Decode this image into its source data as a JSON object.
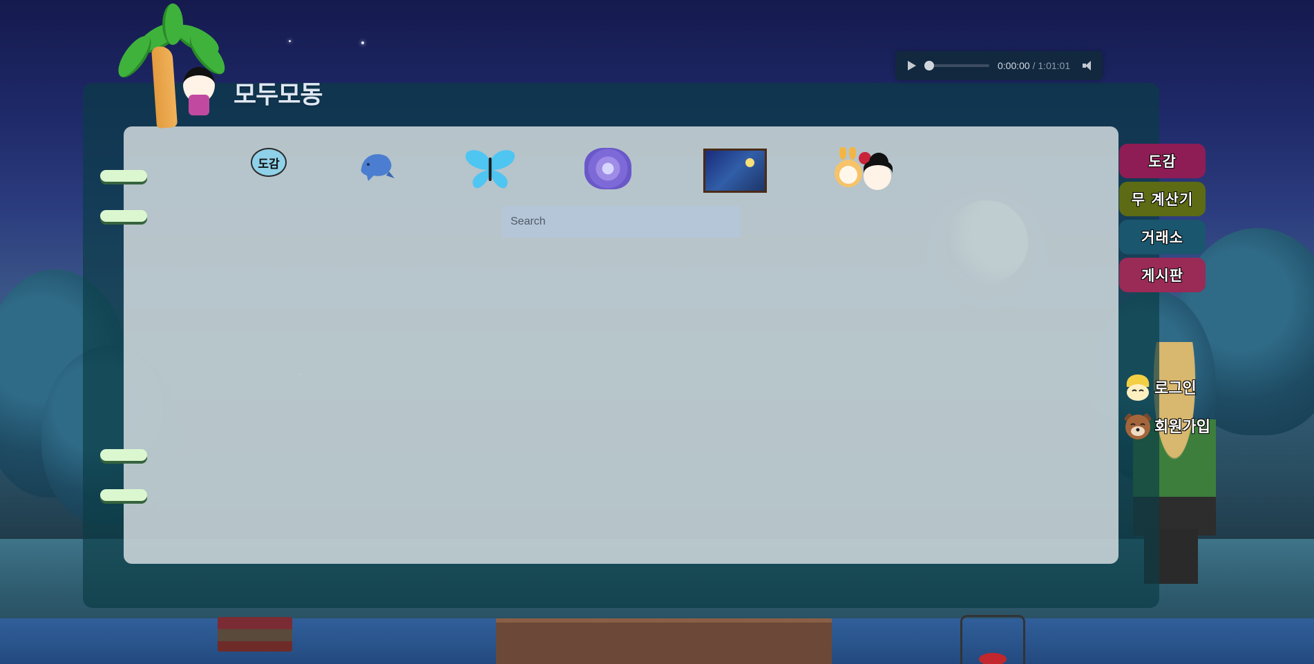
{
  "site": {
    "title": "모두모동"
  },
  "audio": {
    "current_time": "0:00:00",
    "separator": "/",
    "duration": "1:01:01",
    "progress": 0
  },
  "categories": [
    {
      "name": "encyclopedia",
      "icon": "speech-bubble-icon",
      "label": "도감"
    },
    {
      "name": "fish",
      "icon": "fish-icon"
    },
    {
      "name": "insects",
      "icon": "butterfly-icon"
    },
    {
      "name": "fossils",
      "icon": "fossil-icon"
    },
    {
      "name": "art",
      "icon": "painting-icon"
    },
    {
      "name": "villagers",
      "icon": "villagers-icon"
    }
  ],
  "search": {
    "placeholder": "Search",
    "value": ""
  },
  "nav": [
    {
      "label": "도감",
      "color": "#8e1d55"
    },
    {
      "label": "무 계산기",
      "color": "#5c6b14"
    },
    {
      "label": "거래소",
      "color": "#1a566e"
    },
    {
      "label": "게시판",
      "color": "#9a2a56"
    }
  ],
  "auth": {
    "login": {
      "label": "로그인",
      "icon": "isabelle-icon"
    },
    "signup": {
      "label": "회원가입",
      "icon": "tom-nook-icon"
    }
  }
}
